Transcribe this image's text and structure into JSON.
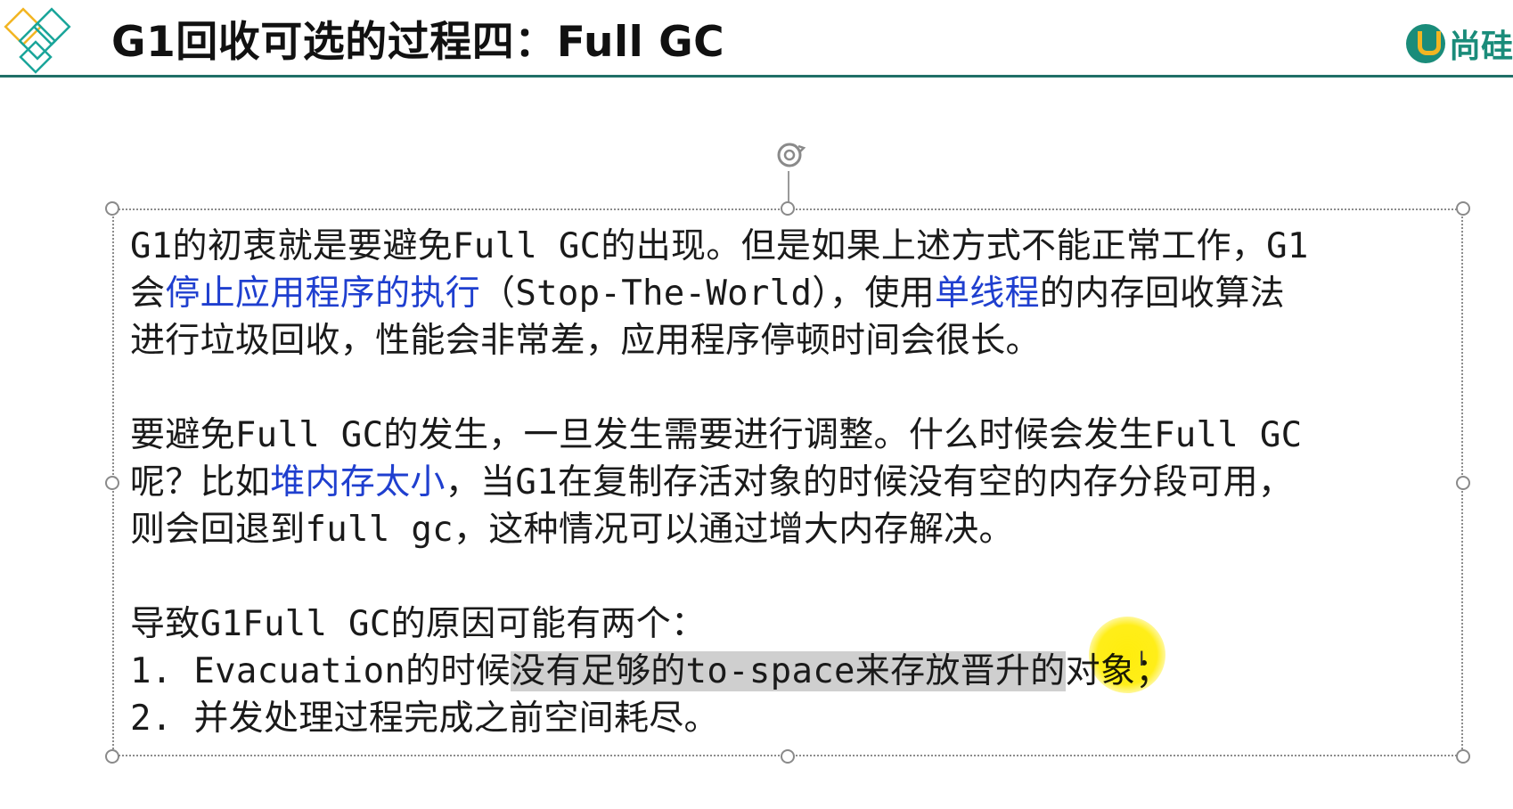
{
  "header": {
    "title": "G1回收可选的过程四：Full GC",
    "brand_text": "尚硅",
    "accent_color": "#1f6f67",
    "brand_color": "#1a8c7a"
  },
  "textbox": {
    "paragraph1": {
      "line1": "G1的初衷就是要避免Full GC的出现。但是如果上述方式不能正常工作，G1",
      "line2_a": "会",
      "line2_b": "停止应用程序的执行",
      "line2_c": "（Stop-The-World），使用",
      "line2_d": "单线程",
      "line2_e": "的内存回收算法",
      "line3": "进行垃圾回收，性能会非常差，应用程序停顿时间会很长。"
    },
    "paragraph2": {
      "line1": "要避免Full GC的发生，一旦发生需要进行调整。什么时候会发生Full GC",
      "line2_a": "呢？比如",
      "line2_b": "堆内存太小",
      "line2_c": "，当G1在复制存活对象的时候没有空的内存分段可用，",
      "line3": "则会回退到full gc，这种情况可以通过增大内存解决。"
    },
    "paragraph3": {
      "line1": "导致G1Full GC的原因可能有两个：",
      "line2_a": "1. Evacuation的时候",
      "line2_b": "没有足够的to-space来存放晋升的",
      "line2_c": "对象；",
      "line3": "2. 并发处理过程完成之前空间耗尽。"
    },
    "link_color": "#1f3fcf"
  },
  "icons": {
    "logo": "diamond-logo-icon",
    "brand": "brand-logo-icon",
    "rotate": "rotate-handle-icon",
    "cursor": "text-cursor-icon"
  }
}
